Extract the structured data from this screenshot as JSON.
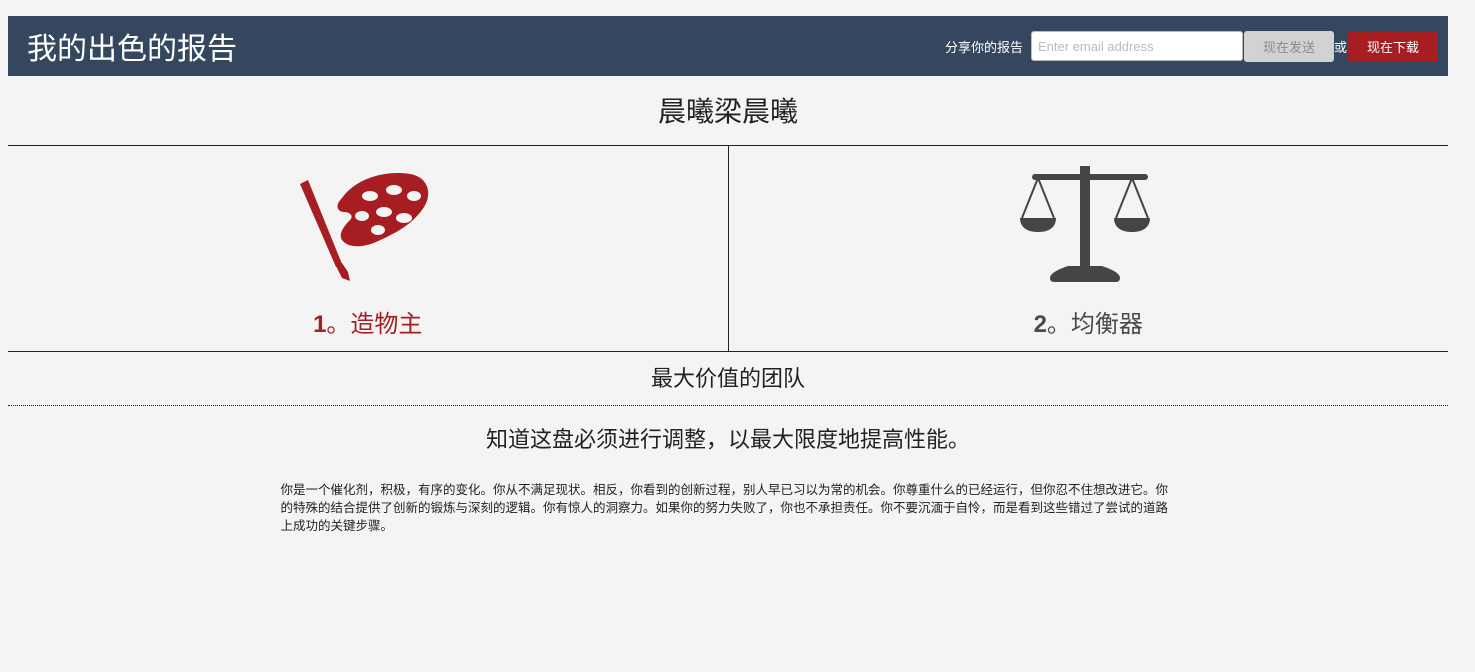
{
  "header": {
    "title": "我的出色的报告",
    "share_label": "分享你的报告",
    "email_placeholder": "Enter email address",
    "send_label": "现在发送",
    "or_label": "或",
    "download_label": "现在下载"
  },
  "person": {
    "name": "晨曦梁晨曦"
  },
  "strengths": [
    {
      "number": "1",
      "separator": "。",
      "name": "造物主",
      "icon": "palette-icon",
      "color": "#a61e22"
    },
    {
      "number": "2",
      "separator": "。",
      "name": "均衡器",
      "icon": "scales-icon",
      "color": "#4a4a4a"
    }
  ],
  "team": {
    "title": "最大价值的团队"
  },
  "content": {
    "subtitle": "知道这盘必须进行调整，以最大限度地提高性能。",
    "description": "你是一个催化剂，积极，有序的变化。你从不满足现状。相反，你看到的创新过程，别人早已习以为常的机会。你尊重什么的已经运行，但你忍不住想改进它。你的特殊的结合提供了创新的锻炼与深刻的逻辑。你有惊人的洞察力。如果你的努力失败了，你也不承担责任。你不要沉湎于自怜，而是看到这些错过了尝试的道路上成功的关键步骤。"
  },
  "colors": {
    "header_bg": "#34475f",
    "accent_red": "#a61e22",
    "page_bg": "#f4f4f4"
  }
}
